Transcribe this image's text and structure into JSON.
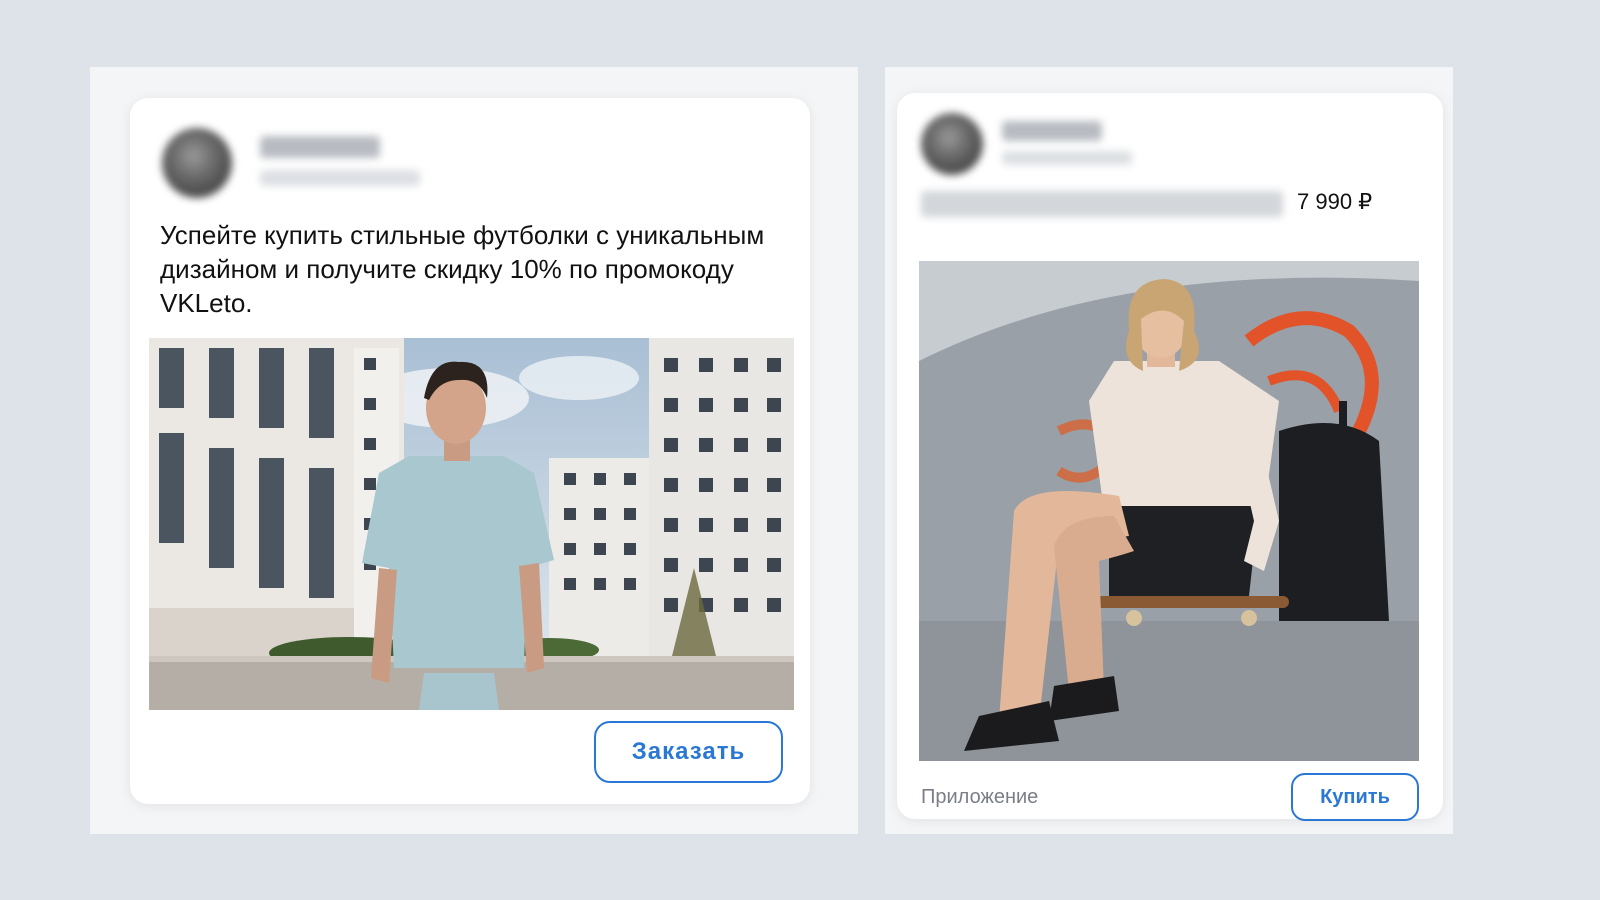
{
  "left_ad": {
    "post_text": "Успейте купить стильные футболки с уникальным дизайном и получите скидку 10% по промокоду VKLeto.",
    "cta_label": "Заказать"
  },
  "right_ad": {
    "price": "7 990 ₽",
    "footer_label": "Приложение",
    "cta_label": "Купить"
  },
  "colors": {
    "background": "#dde3e8",
    "accent": "#2a78d4",
    "card": "#ffffff"
  },
  "icons": {
    "avatar": "avatar-blurred"
  }
}
